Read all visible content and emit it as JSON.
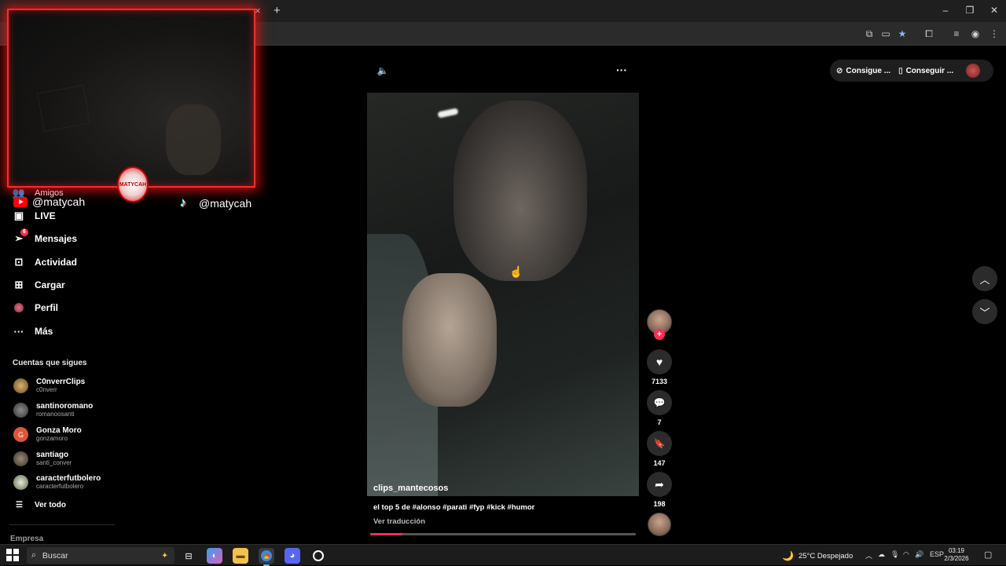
{
  "browser": {
    "new_tab_label": "+",
    "close_tab_label": "×",
    "toolbar_icons": [
      "translate-icon",
      "cast-icon",
      "star-icon",
      "extensions-icon",
      "media-icon",
      "profile-icon",
      "menu-icon"
    ],
    "window_controls": {
      "minimize": "–",
      "restore": "❐",
      "close": "✕"
    }
  },
  "overlay": {
    "badge_text": "MATYCAH",
    "youtube_handle": "@matycah",
    "tiktok_handle": "@matycah"
  },
  "sidebar": {
    "items": [
      {
        "label": "Amigos",
        "icon": "friends-icon"
      },
      {
        "label": "LIVE",
        "icon": "live-icon"
      },
      {
        "label": "Mensajes",
        "icon": "messages-icon",
        "badge": "6"
      },
      {
        "label": "Actividad",
        "icon": "activity-icon"
      },
      {
        "label": "Cargar",
        "icon": "upload-icon"
      },
      {
        "label": "Perfil",
        "icon": "profile-icon"
      },
      {
        "label": "Más",
        "icon": "more-icon"
      }
    ],
    "following_title": "Cuentas que sigues",
    "following": [
      {
        "name": "C0nverrClips",
        "handle": "c0nverr",
        "avatar": ""
      },
      {
        "name": "santinoromano",
        "handle": "romanoosanti",
        "avatar": ""
      },
      {
        "name": "Gonza Moro",
        "handle": "gonzamoro",
        "avatar": "G"
      },
      {
        "name": "santiago",
        "handle": "santi_conver",
        "avatar": ""
      },
      {
        "name": "caracterfutbolero",
        "handle": "caracterfutbolero",
        "avatar": ""
      }
    ],
    "see_all": "Ver todo",
    "company": "Empresa"
  },
  "video": {
    "author": "clips_mantecosos",
    "caption": "el top 5 de #alonso #parati #fyp #kick #humor",
    "translate": "Ver traducción",
    "progress": 0.12
  },
  "actions": {
    "likes": "7133",
    "comments": "7",
    "saves": "147",
    "shares": "198"
  },
  "top_bar": {
    "get_coins": "Consigue ...",
    "get_app": "Conseguir ..."
  },
  "taskbar": {
    "search_placeholder": "Buscar",
    "weather": "25°C  Despejado",
    "language": "ESP",
    "time": "03:19",
    "date": "2/3/2026"
  },
  "colors": {
    "accent": "#fe2c55",
    "overlay_border": "#ff2a2a"
  }
}
